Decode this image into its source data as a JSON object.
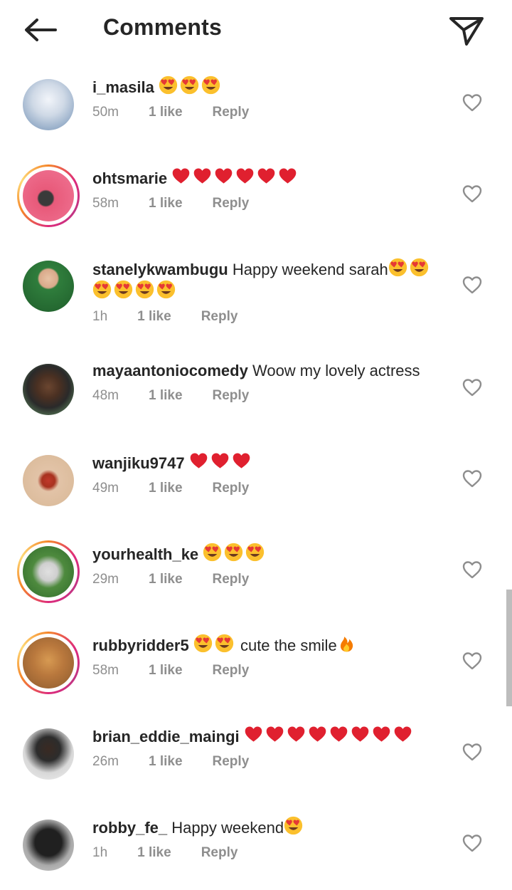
{
  "header": {
    "title": "Comments",
    "back_icon": "arrow-left-icon",
    "share_icon": "paper-plane-icon"
  },
  "colors": {
    "text": "#262626",
    "meta": "#8e8e8e",
    "heart_red": "#e0202f",
    "story_ring": "#dd2a7b"
  },
  "comments": [
    {
      "username": "i_masila",
      "text": "",
      "emoji": [
        "heart-eyes",
        "heart-eyes",
        "heart-eyes"
      ],
      "time": "50m",
      "likes": "1 like",
      "reply": "Reply",
      "story_ring": false
    },
    {
      "username": "ohtsmarie",
      "text": "",
      "emoji": [
        "red-heart",
        "red-heart",
        "red-heart",
        "red-heart",
        "red-heart",
        "red-heart"
      ],
      "time": "58m",
      "likes": "1 like",
      "reply": "Reply",
      "story_ring": true
    },
    {
      "username": "stanelykwambugu",
      "text": "Happy weekend sarah",
      "emoji": [
        "heart-eyes",
        "heart-eyes",
        "heart-eyes",
        "heart-eyes",
        "heart-eyes",
        "heart-eyes"
      ],
      "time": "1h",
      "likes": "1 like",
      "reply": "Reply",
      "story_ring": false
    },
    {
      "username": "mayaantoniocomedy",
      "text": "Woow my lovely actress",
      "emoji": [],
      "time": "48m",
      "likes": "1 like",
      "reply": "Reply",
      "story_ring": false
    },
    {
      "username": "wanjiku9747",
      "text": "",
      "emoji": [
        "red-heart",
        "red-heart",
        "red-heart"
      ],
      "time": "49m",
      "likes": "1 like",
      "reply": "Reply",
      "story_ring": false
    },
    {
      "username": "yourhealth_ke",
      "text": "",
      "emoji": [
        "heart-eyes",
        "heart-eyes",
        "heart-eyes"
      ],
      "time": "29m",
      "likes": "1 like",
      "reply": "Reply",
      "story_ring": true
    },
    {
      "username": "rubbyridder5",
      "text": "cute the smile",
      "emoji_before": [
        "heart-eyes",
        "heart-eyes"
      ],
      "emoji": [
        "fire"
      ],
      "time": "58m",
      "likes": "1 like",
      "reply": "Reply",
      "story_ring": true
    },
    {
      "username": "brian_eddie_maingi",
      "text": "",
      "emoji": [
        "red-heart",
        "red-heart",
        "red-heart",
        "red-heart",
        "red-heart",
        "red-heart",
        "red-heart",
        "red-heart"
      ],
      "time": "26m",
      "likes": "1 like",
      "reply": "Reply",
      "story_ring": false
    },
    {
      "username": "robby_fe_",
      "text": "Happy weekend",
      "emoji": [
        "heart-eyes"
      ],
      "time": "1h",
      "likes": "1 like",
      "reply": "Reply",
      "story_ring": false
    }
  ]
}
